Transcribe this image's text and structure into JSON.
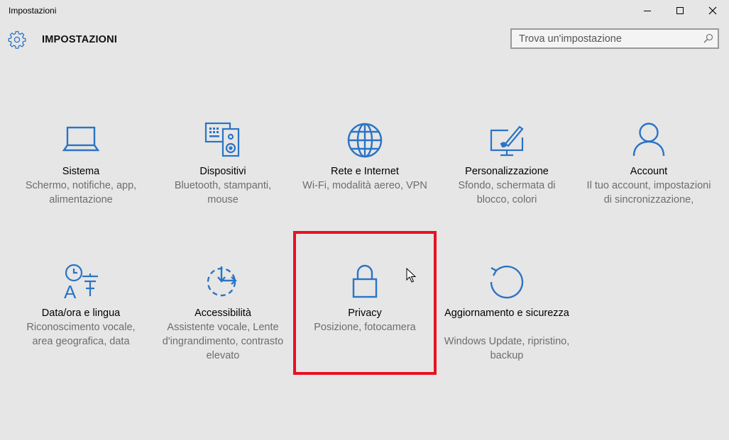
{
  "window": {
    "title": "Impostazioni"
  },
  "header": {
    "title": "IMPOSTAZIONI",
    "search_placeholder": "Trova un'impostazione"
  },
  "tiles": [
    {
      "name": "Sistema",
      "description": "Schermo, notifiche, app, alimentazione",
      "icon": "laptop-icon"
    },
    {
      "name": "Dispositivi",
      "description": "Bluetooth, stampanti, mouse",
      "icon": "devices-icon"
    },
    {
      "name": "Rete e Internet",
      "description": "Wi-Fi, modalità aereo, VPN",
      "icon": "globe-icon"
    },
    {
      "name": "Personalizzazione",
      "description": "Sfondo, schermata di blocco, colori",
      "icon": "paint-icon"
    },
    {
      "name": "Account",
      "description": "Il tuo account, impostazioni di sincronizzazione,",
      "icon": "person-icon"
    },
    {
      "name": "Data/ora e lingua",
      "description": "Riconoscimento vocale, area geografica, data",
      "icon": "time-language-icon"
    },
    {
      "name": "Accessibilità",
      "description": "Assistente vocale, Lente d'ingrandimento, contrasto elevato",
      "icon": "ease-of-access-icon"
    },
    {
      "name": "Privacy",
      "description": "Posizione, fotocamera",
      "icon": "lock-icon"
    },
    {
      "name": "Aggiornamento e sicurezza",
      "description": "Windows Update, ripristino, backup",
      "icon": "update-icon"
    }
  ],
  "colors": {
    "accent": "#2a74c5",
    "background": "#e6e6e6",
    "highlight": "#e81123"
  }
}
